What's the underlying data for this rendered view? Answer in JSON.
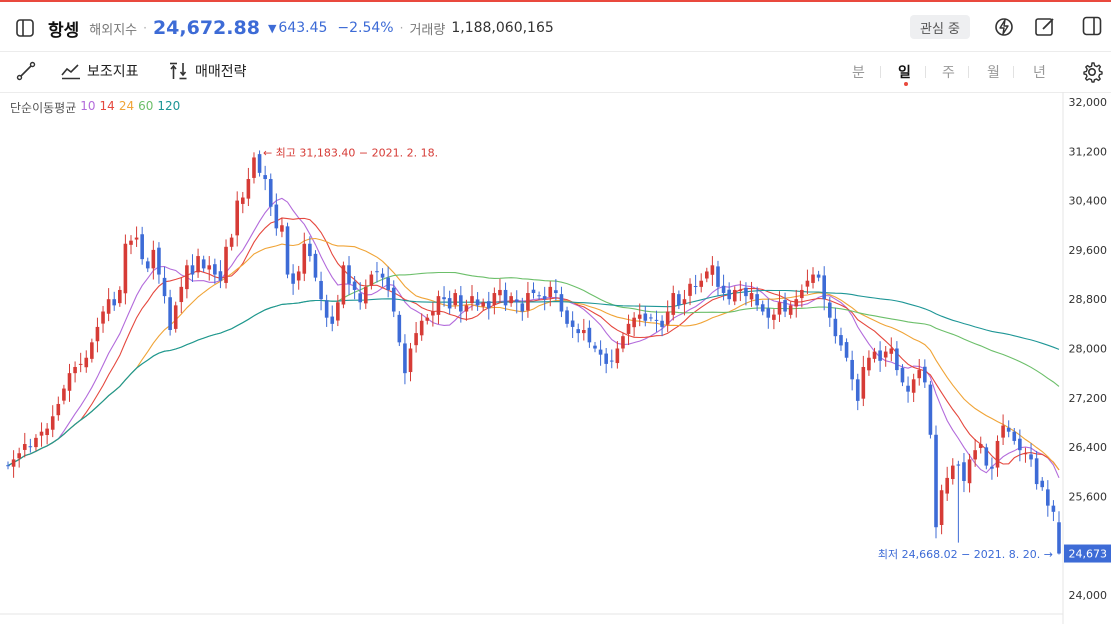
{
  "header": {
    "title": "항셍",
    "subtitle": "해외지수",
    "price": "24,672.88",
    "change_arrow": "▼",
    "change": "643.45",
    "change_pct": "−2.54%",
    "volume_label": "거래량",
    "volume": "1,188,060,165",
    "watch_label": "관심 중"
  },
  "toolbar": {
    "indicator_label": "보조지표",
    "strategy_label": "매매전략",
    "periods": [
      "분",
      "일",
      "주",
      "월",
      "년"
    ],
    "active_period": "일"
  },
  "legend": {
    "label": "단순이동평균",
    "items": [
      {
        "text": "10",
        "color": "#b36bdb"
      },
      {
        "text": "14",
        "color": "#e5483e"
      },
      {
        "text": "24",
        "color": "#f0a437"
      },
      {
        "text": "60",
        "color": "#6cbf6a"
      },
      {
        "text": "120",
        "color": "#1e9696"
      }
    ]
  },
  "colors": {
    "up": "#d63b36",
    "down": "#3d6bd6",
    "accent_top": "#e9493d"
  },
  "chart_data": {
    "type": "candlestick",
    "ylim": [
      24000,
      32000
    ],
    "yticks": [
      "32,000",
      "31,200",
      "30,400",
      "29,600",
      "28,800",
      "28,000",
      "27,200",
      "26,400",
      "25,600",
      "24,000"
    ],
    "ytick_values": [
      32000,
      31200,
      30400,
      29600,
      28800,
      28000,
      27200,
      26400,
      25600,
      24000
    ],
    "last_price_label": "24,673",
    "last_price": 24673,
    "high_annotation": "← 최고 31,183.40 − 2021. 2. 18.",
    "high_value": 31183.4,
    "low_annotation": "최저 24,668.02 − 2021. 8. 20. →",
    "low_value": 24668.02,
    "close_path": [
      26100,
      26200,
      26300,
      26450,
      26400,
      26550,
      26650,
      26700,
      26900,
      27100,
      27350,
      27600,
      27700,
      27750,
      27850,
      28100,
      28350,
      28600,
      28800,
      28700,
      28950,
      29700,
      29750,
      29800,
      29450,
      29300,
      29600,
      29200,
      28850,
      28300,
      28700,
      29000,
      29350,
      29200,
      29500,
      29300,
      29350,
      29200,
      29100,
      29650,
      29800,
      30400,
      30450,
      30750,
      31100,
      30850,
      30750,
      30300,
      29950,
      30000,
      29200,
      29050,
      29250,
      29700,
      29500,
      29150,
      28800,
      28500,
      28400,
      28750,
      29350,
      29050,
      28950,
      28750,
      29000,
      29200,
      29250,
      29150,
      28950,
      28600,
      28100,
      27600,
      28000,
      28250,
      28450,
      28500,
      28600,
      28850,
      28800,
      28650,
      28900,
      28600,
      28700,
      28850,
      28700,
      28750,
      28650,
      28900,
      28950,
      28700,
      28850,
      28750,
      28600,
      28900,
      28900,
      28850,
      28800,
      29000,
      28900,
      28600,
      28400,
      28350,
      28250,
      28300,
      28100,
      28000,
      27900,
      27750,
      27800,
      28000,
      28200,
      28400,
      28500,
      28550,
      28450,
      28500,
      28450,
      28350,
      28600,
      28900,
      28700,
      28800,
      29050,
      29000,
      29100,
      29250,
      29350,
      29000,
      28900,
      28800,
      28950,
      28950,
      28850,
      28900,
      28700,
      28600,
      28500,
      28550,
      28750,
      28600,
      28700,
      28800,
      28950,
      29100,
      29200,
      29150,
      28800,
      28500,
      28200,
      28050,
      27850,
      27500,
      27150,
      27700,
      27850,
      27950,
      27800,
      27950,
      28000,
      27650,
      27450,
      27300,
      27500,
      27650,
      27450,
      26600,
      25100,
      25700,
      25900,
      26100,
      26100,
      25850,
      26200,
      26350,
      26450,
      26100,
      26050,
      26500,
      26750,
      26650,
      26500,
      26350,
      26300,
      26200,
      25800,
      25750,
      25450,
      25350,
      24673
    ]
  }
}
